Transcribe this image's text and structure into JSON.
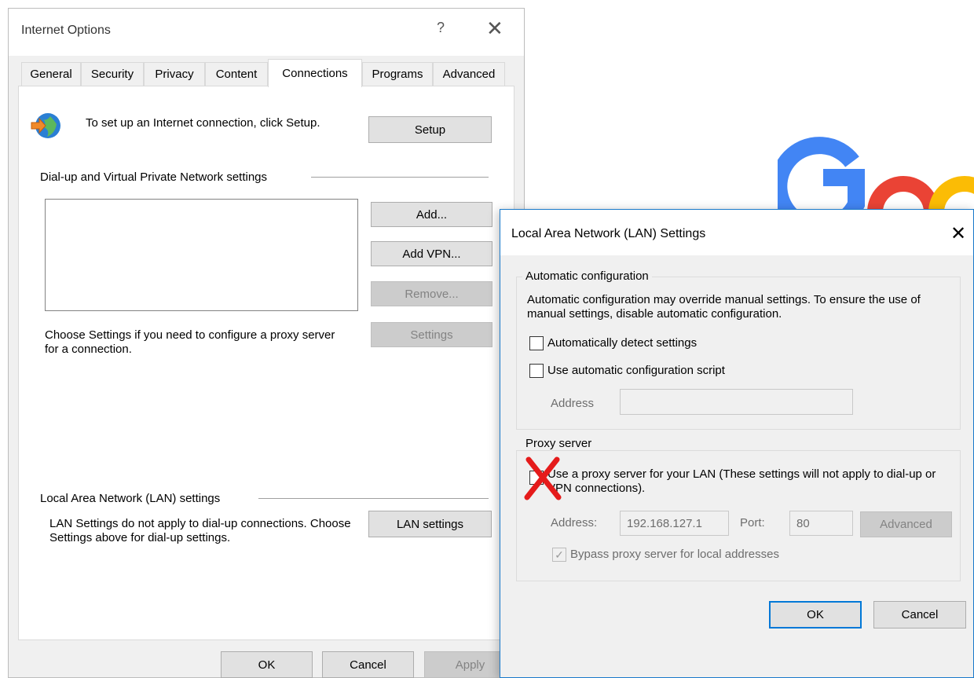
{
  "internet_options": {
    "title": "Internet Options",
    "help_glyph": "?",
    "close_glyph": "✕",
    "tabs": [
      {
        "label": "General"
      },
      {
        "label": "Security"
      },
      {
        "label": "Privacy"
      },
      {
        "label": "Content"
      },
      {
        "label": "Connections"
      },
      {
        "label": "Programs"
      },
      {
        "label": "Advanced"
      }
    ],
    "active_tab": "Connections",
    "setup_text": "To set up an Internet connection, click Setup.",
    "setup_button": "Setup",
    "dialup_heading": "Dial-up and Virtual Private Network settings",
    "add_button": "Add...",
    "add_vpn_button": "Add VPN...",
    "remove_button": "Remove...",
    "settings_text": "Choose Settings if you need to configure a proxy server for a connection.",
    "settings_button": "Settings",
    "lan_heading": "Local Area Network (LAN) settings",
    "lan_text": "LAN Settings do not apply to dial-up connections. Choose Settings above for dial-up settings.",
    "lan_settings_button": "LAN settings",
    "ok_button": "OK",
    "cancel_button": "Cancel",
    "apply_button": "Apply"
  },
  "lan_dialog": {
    "title": "Local Area Network (LAN) Settings",
    "close_glyph": "✕",
    "auto_config_label": "Automatic configuration",
    "auto_config_text": "Automatic configuration may override manual settings.  To ensure the use of manual settings, disable automatic configuration.",
    "auto_detect_label": "Automatically detect settings",
    "auto_detect_checked": false,
    "auto_script_label": "Use automatic configuration script",
    "auto_script_checked": false,
    "address_label": "Address",
    "address_value": "",
    "proxy_label": "Proxy server",
    "use_proxy_label": "Use a proxy server for your LAN (These settings will not apply to dial-up or VPN connections).",
    "use_proxy_checked": false,
    "proxy_address_label": "Address:",
    "proxy_address_value": "192.168.127.1",
    "port_label": "Port:",
    "port_value": "80",
    "advanced_button": "Advanced",
    "bypass_label": "Bypass proxy server for local addresses",
    "bypass_checked": true,
    "ok_button": "OK",
    "cancel_button": "Cancel",
    "annotation_mark": "red-x-mark"
  },
  "colors": {
    "google_blue": "#4285F4",
    "google_red": "#EA4335",
    "google_yellow": "#FBBC05",
    "annotation_red": "#e51b1b",
    "focus_blue": "#0078d7"
  }
}
